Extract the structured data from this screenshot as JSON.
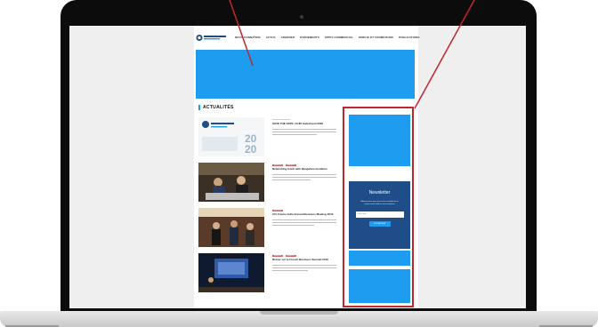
{
  "nav": {
    "logo_text": "CCI FRANCE INDE",
    "items": [
      "NOUS CONNAÎTRE",
      "ACTUS",
      "ADHÉRER",
      "ÉVÉNEMENTS",
      "APPUI COMMERCIAL",
      "EMPLOI ET FORMATIONS",
      "PUBLICATIONS"
    ]
  },
  "section": {
    "title": "ACTUALITÉS"
  },
  "news": [
    {
      "meta": "",
      "tags": [],
      "title": "SAVE THE DATE: CCIFI Gala Event 2020",
      "date_line": "",
      "thumb_text": "SAVE THE DATE",
      "thumb_year": "2020"
    },
    {
      "meta": "",
      "tags": [
        "EVENTS",
        "EVENTS"
      ],
      "title": "Networking lunch with Bengaluru members",
      "date_line": "",
      "thumb_text": "",
      "thumb_year": ""
    },
    {
      "meta": "",
      "tags": [
        "EVENTS"
      ],
      "title": "CCI France India Annual Business Meeting 2019",
      "date_line": "",
      "thumb_text": "",
      "thumb_year": ""
    },
    {
      "meta": "",
      "tags": [
        "EVENTS",
        "EVENTS"
      ],
      "title": "Retour sur le French Business Summit 2019",
      "date_line": "",
      "thumb_text": "",
      "thumb_year": ""
    }
  ],
  "newsletter": {
    "title": "Newsletter",
    "text": "Abonnez-vous pour recevoir les actualités de la communauté d'affaires franco-indienne",
    "placeholder": "Votre email",
    "button": "JE M'ABONNE"
  },
  "colors": {
    "accent": "#1d9cf0",
    "newsletter_bg": "#1f4d87",
    "highlight": "#c0272d"
  }
}
